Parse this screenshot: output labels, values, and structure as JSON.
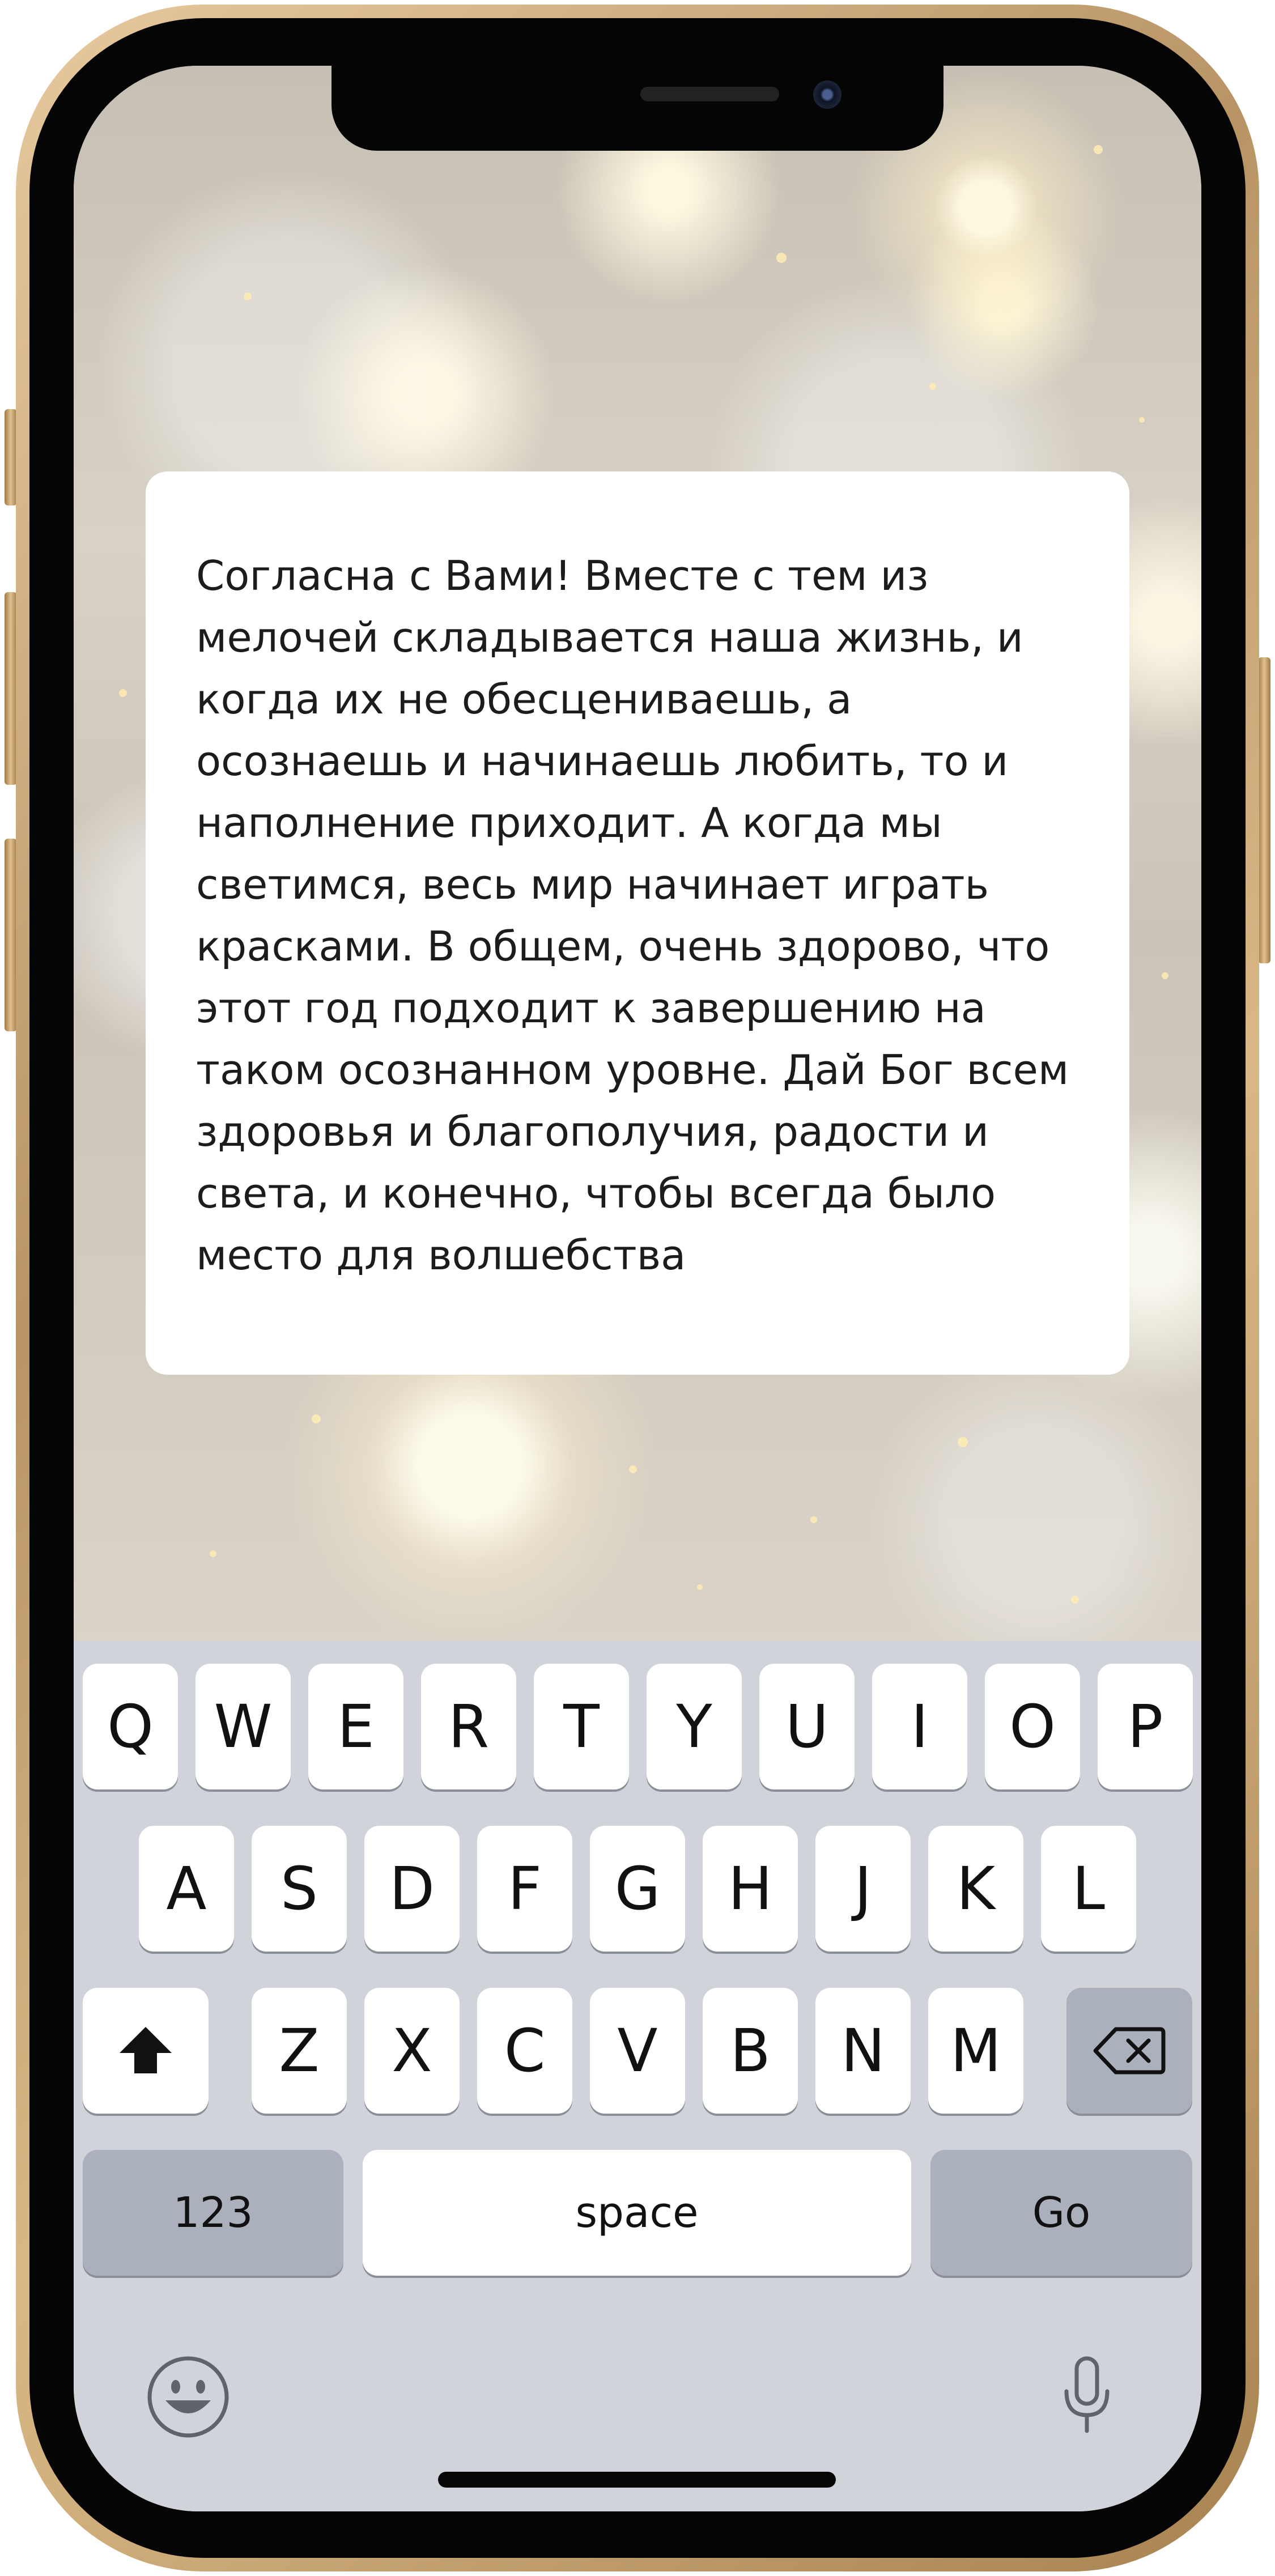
{
  "message": {
    "text": "Согласна с Вами! Вместе с тем из мелочей складывается наша жизнь, и когда их не обесцениваешь, а осознаешь и начинаешь любить, то и наполнение приходит. А когда мы светимся, весь мир начинает играть красками. В общем, очень здорово, что этот год подходит к завершению на таком осознанном уровне. Дай Бог всем здоровья и благополучия, радости и света, и конечно, чтобы всегда было место для волшебства"
  },
  "keyboard": {
    "row1": [
      "Q",
      "W",
      "E",
      "R",
      "T",
      "Y",
      "U",
      "I",
      "O",
      "P"
    ],
    "row2": [
      "A",
      "S",
      "D",
      "F",
      "G",
      "H",
      "J",
      "K",
      "L"
    ],
    "row3": [
      "Z",
      "X",
      "C",
      "V",
      "B",
      "N",
      "M"
    ],
    "numbers_label": "123",
    "space_label": "space",
    "go_label": "Go",
    "icons": {
      "shift": "shift-icon",
      "delete": "delete-icon",
      "emoji": "emoji-icon",
      "mic": "microphone-icon"
    }
  },
  "colors": {
    "frame_gold": "#c9a774",
    "keyboard_bg": "#d0d3d9",
    "key_gray": "#abb1bc"
  }
}
